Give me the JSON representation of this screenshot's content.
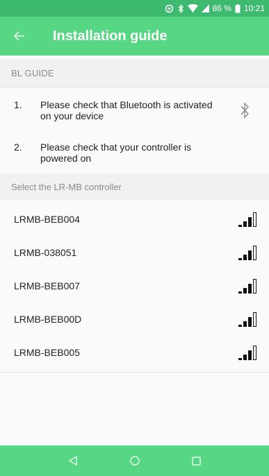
{
  "status_bar": {
    "battery": "86 %",
    "time": "10:21"
  },
  "app_bar": {
    "title": "Installation guide"
  },
  "bl_guide": {
    "header": "BL GUIDE",
    "steps": [
      {
        "number": "1.",
        "text": "Please check that Bluetooth is activated on your device"
      },
      {
        "number": "2.",
        "text": "Please check that your controller is powered on"
      }
    ]
  },
  "controllers": {
    "header": "Select the LR-MB controller",
    "devices": [
      {
        "name": "LRMB-BEB004",
        "signal_level": 3,
        "signal_max": 4
      },
      {
        "name": "LRMB-038051",
        "signal_level": 3,
        "signal_max": 4
      },
      {
        "name": "LRMB-BEB007",
        "signal_level": 3,
        "signal_max": 4
      },
      {
        "name": "LRMB-BEB00D",
        "signal_level": 3,
        "signal_max": 4
      },
      {
        "name": "LRMB-BEB005",
        "signal_level": 3,
        "signal_max": 4
      }
    ]
  },
  "colors": {
    "status_bar": "#3dba6f",
    "app_bar": "#57d684",
    "nav_bar": "#57d684"
  },
  "icons": {
    "back": "arrow-left-icon",
    "bluetooth": "bluetooth-icon",
    "nav_back": "triangle-back-icon",
    "nav_home": "circle-home-icon",
    "nav_recents": "square-recents-icon"
  }
}
